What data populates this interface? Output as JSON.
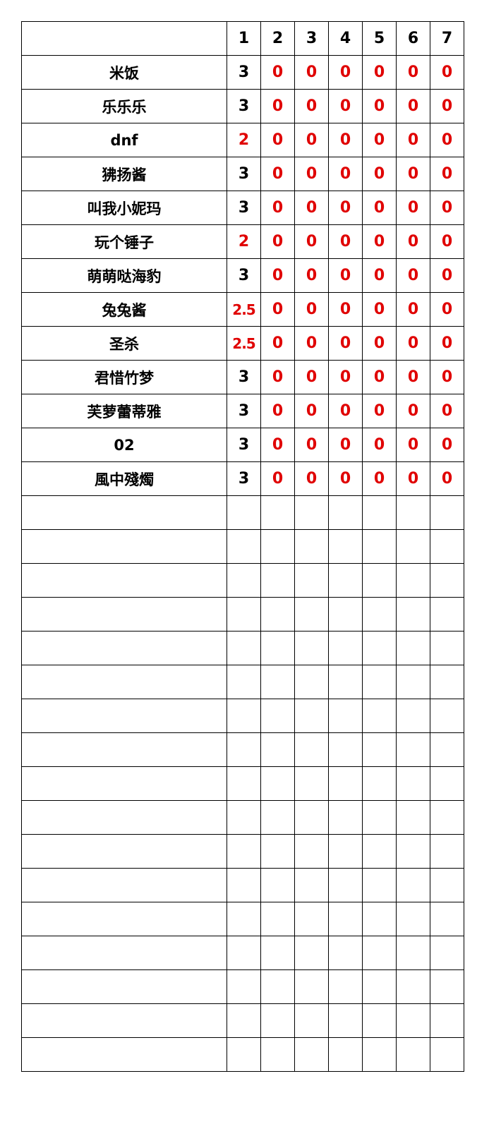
{
  "colors": {
    "black": "#000000",
    "red": "#e00000",
    "grid": "#000000"
  },
  "header": {
    "name": "",
    "cols": [
      "1",
      "2",
      "3",
      "4",
      "5",
      "6",
      "7"
    ]
  },
  "rows": [
    {
      "name": "米饭",
      "scores": [
        {
          "v": "3",
          "red": false
        },
        {
          "v": "0",
          "red": true
        },
        {
          "v": "0",
          "red": true
        },
        {
          "v": "0",
          "red": true
        },
        {
          "v": "0",
          "red": true
        },
        {
          "v": "0",
          "red": true
        },
        {
          "v": "0",
          "red": true
        }
      ]
    },
    {
      "name": "乐乐乐",
      "scores": [
        {
          "v": "3",
          "red": false
        },
        {
          "v": "0",
          "red": true
        },
        {
          "v": "0",
          "red": true
        },
        {
          "v": "0",
          "red": true
        },
        {
          "v": "0",
          "red": true
        },
        {
          "v": "0",
          "red": true
        },
        {
          "v": "0",
          "red": true
        }
      ]
    },
    {
      "name": "dnf",
      "scores": [
        {
          "v": "2",
          "red": true
        },
        {
          "v": "0",
          "red": true
        },
        {
          "v": "0",
          "red": true
        },
        {
          "v": "0",
          "red": true
        },
        {
          "v": "0",
          "red": true
        },
        {
          "v": "0",
          "red": true
        },
        {
          "v": "0",
          "red": true
        }
      ]
    },
    {
      "name": "狒扬酱",
      "scores": [
        {
          "v": "3",
          "red": false
        },
        {
          "v": "0",
          "red": true
        },
        {
          "v": "0",
          "red": true
        },
        {
          "v": "0",
          "red": true
        },
        {
          "v": "0",
          "red": true
        },
        {
          "v": "0",
          "red": true
        },
        {
          "v": "0",
          "red": true
        }
      ]
    },
    {
      "name": "叫我小妮玛",
      "scores": [
        {
          "v": "3",
          "red": false
        },
        {
          "v": "0",
          "red": true
        },
        {
          "v": "0",
          "red": true
        },
        {
          "v": "0",
          "red": true
        },
        {
          "v": "0",
          "red": true
        },
        {
          "v": "0",
          "red": true
        },
        {
          "v": "0",
          "red": true
        }
      ]
    },
    {
      "name": "玩个锤子",
      "scores": [
        {
          "v": "2",
          "red": true
        },
        {
          "v": "0",
          "red": true
        },
        {
          "v": "0",
          "red": true
        },
        {
          "v": "0",
          "red": true
        },
        {
          "v": "0",
          "red": true
        },
        {
          "v": "0",
          "red": true
        },
        {
          "v": "0",
          "red": true
        }
      ]
    },
    {
      "name": "萌萌哒海豹",
      "scores": [
        {
          "v": "3",
          "red": false
        },
        {
          "v": "0",
          "red": true
        },
        {
          "v": "0",
          "red": true
        },
        {
          "v": "0",
          "red": true
        },
        {
          "v": "0",
          "red": true
        },
        {
          "v": "0",
          "red": true
        },
        {
          "v": "0",
          "red": true
        }
      ]
    },
    {
      "name": "兔兔酱",
      "scores": [
        {
          "v": "2.5",
          "red": true
        },
        {
          "v": "0",
          "red": true
        },
        {
          "v": "0",
          "red": true
        },
        {
          "v": "0",
          "red": true
        },
        {
          "v": "0",
          "red": true
        },
        {
          "v": "0",
          "red": true
        },
        {
          "v": "0",
          "red": true
        }
      ]
    },
    {
      "name": "圣杀",
      "scores": [
        {
          "v": "2.5",
          "red": true
        },
        {
          "v": "0",
          "red": true
        },
        {
          "v": "0",
          "red": true
        },
        {
          "v": "0",
          "red": true
        },
        {
          "v": "0",
          "red": true
        },
        {
          "v": "0",
          "red": true
        },
        {
          "v": "0",
          "red": true
        }
      ]
    },
    {
      "name": "君惜竹梦",
      "scores": [
        {
          "v": "3",
          "red": false
        },
        {
          "v": "0",
          "red": true
        },
        {
          "v": "0",
          "red": true
        },
        {
          "v": "0",
          "red": true
        },
        {
          "v": "0",
          "red": true
        },
        {
          "v": "0",
          "red": true
        },
        {
          "v": "0",
          "red": true
        }
      ]
    },
    {
      "name": "芙萝蕾蒂雅",
      "scores": [
        {
          "v": "3",
          "red": false
        },
        {
          "v": "0",
          "red": true
        },
        {
          "v": "0",
          "red": true
        },
        {
          "v": "0",
          "red": true
        },
        {
          "v": "0",
          "red": true
        },
        {
          "v": "0",
          "red": true
        },
        {
          "v": "0",
          "red": true
        }
      ]
    },
    {
      "name": "02",
      "scores": [
        {
          "v": "3",
          "red": false
        },
        {
          "v": "0",
          "red": true
        },
        {
          "v": "0",
          "red": true
        },
        {
          "v": "0",
          "red": true
        },
        {
          "v": "0",
          "red": true
        },
        {
          "v": "0",
          "red": true
        },
        {
          "v": "0",
          "red": true
        }
      ]
    },
    {
      "name": "風中殘燭",
      "scores": [
        {
          "v": "3",
          "red": false
        },
        {
          "v": "0",
          "red": true
        },
        {
          "v": "0",
          "red": true
        },
        {
          "v": "0",
          "red": true
        },
        {
          "v": "0",
          "red": true
        },
        {
          "v": "0",
          "red": true
        },
        {
          "v": "0",
          "red": true
        }
      ]
    },
    {
      "name": "",
      "scores": [
        {
          "v": ""
        },
        {
          "v": ""
        },
        {
          "v": ""
        },
        {
          "v": ""
        },
        {
          "v": ""
        },
        {
          "v": ""
        },
        {
          "v": ""
        }
      ]
    },
    {
      "name": "",
      "scores": [
        {
          "v": ""
        },
        {
          "v": ""
        },
        {
          "v": ""
        },
        {
          "v": ""
        },
        {
          "v": ""
        },
        {
          "v": ""
        },
        {
          "v": ""
        }
      ]
    },
    {
      "name": "",
      "scores": [
        {
          "v": ""
        },
        {
          "v": ""
        },
        {
          "v": ""
        },
        {
          "v": ""
        },
        {
          "v": ""
        },
        {
          "v": ""
        },
        {
          "v": ""
        }
      ]
    },
    {
      "name": "",
      "scores": [
        {
          "v": ""
        },
        {
          "v": ""
        },
        {
          "v": ""
        },
        {
          "v": ""
        },
        {
          "v": ""
        },
        {
          "v": ""
        },
        {
          "v": ""
        }
      ]
    },
    {
      "name": "",
      "scores": [
        {
          "v": ""
        },
        {
          "v": ""
        },
        {
          "v": ""
        },
        {
          "v": ""
        },
        {
          "v": ""
        },
        {
          "v": ""
        },
        {
          "v": ""
        }
      ]
    },
    {
      "name": "",
      "scores": [
        {
          "v": ""
        },
        {
          "v": ""
        },
        {
          "v": ""
        },
        {
          "v": ""
        },
        {
          "v": ""
        },
        {
          "v": ""
        },
        {
          "v": ""
        }
      ]
    },
    {
      "name": "",
      "scores": [
        {
          "v": ""
        },
        {
          "v": ""
        },
        {
          "v": ""
        },
        {
          "v": ""
        },
        {
          "v": ""
        },
        {
          "v": ""
        },
        {
          "v": ""
        }
      ]
    },
    {
      "name": "",
      "scores": [
        {
          "v": ""
        },
        {
          "v": ""
        },
        {
          "v": ""
        },
        {
          "v": ""
        },
        {
          "v": ""
        },
        {
          "v": ""
        },
        {
          "v": ""
        }
      ]
    },
    {
      "name": "",
      "scores": [
        {
          "v": ""
        },
        {
          "v": ""
        },
        {
          "v": ""
        },
        {
          "v": ""
        },
        {
          "v": ""
        },
        {
          "v": ""
        },
        {
          "v": ""
        }
      ]
    },
    {
      "name": "",
      "scores": [
        {
          "v": ""
        },
        {
          "v": ""
        },
        {
          "v": ""
        },
        {
          "v": ""
        },
        {
          "v": ""
        },
        {
          "v": ""
        },
        {
          "v": ""
        }
      ]
    },
    {
      "name": "",
      "scores": [
        {
          "v": ""
        },
        {
          "v": ""
        },
        {
          "v": ""
        },
        {
          "v": ""
        },
        {
          "v": ""
        },
        {
          "v": ""
        },
        {
          "v": ""
        }
      ]
    },
    {
      "name": "",
      "scores": [
        {
          "v": ""
        },
        {
          "v": ""
        },
        {
          "v": ""
        },
        {
          "v": ""
        },
        {
          "v": ""
        },
        {
          "v": ""
        },
        {
          "v": ""
        }
      ]
    },
    {
      "name": "",
      "scores": [
        {
          "v": ""
        },
        {
          "v": ""
        },
        {
          "v": ""
        },
        {
          "v": ""
        },
        {
          "v": ""
        },
        {
          "v": ""
        },
        {
          "v": ""
        }
      ]
    },
    {
      "name": "",
      "scores": [
        {
          "v": ""
        },
        {
          "v": ""
        },
        {
          "v": ""
        },
        {
          "v": ""
        },
        {
          "v": ""
        },
        {
          "v": ""
        },
        {
          "v": ""
        }
      ]
    },
    {
      "name": "",
      "scores": [
        {
          "v": ""
        },
        {
          "v": ""
        },
        {
          "v": ""
        },
        {
          "v": ""
        },
        {
          "v": ""
        },
        {
          "v": ""
        },
        {
          "v": ""
        }
      ]
    },
    {
      "name": "",
      "scores": [
        {
          "v": ""
        },
        {
          "v": ""
        },
        {
          "v": ""
        },
        {
          "v": ""
        },
        {
          "v": ""
        },
        {
          "v": ""
        },
        {
          "v": ""
        }
      ]
    },
    {
      "name": "",
      "scores": [
        {
          "v": ""
        },
        {
          "v": ""
        },
        {
          "v": ""
        },
        {
          "v": ""
        },
        {
          "v": ""
        },
        {
          "v": ""
        },
        {
          "v": ""
        }
      ]
    }
  ]
}
